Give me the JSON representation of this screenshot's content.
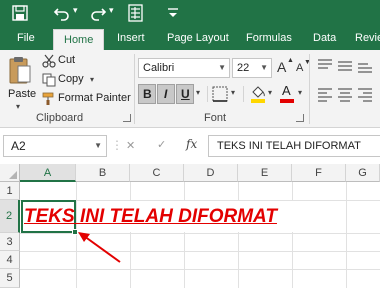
{
  "colors": {
    "accent": "#217346",
    "ribbon_bg": "#f3f3f3",
    "cell_text": "#e30000",
    "fill_highlight": "#ffd700",
    "font_color_bar": "#e30000"
  },
  "titlebar": {
    "icons": [
      "save-icon",
      "undo-icon",
      "redo-icon",
      "form-icon",
      "customize-quick-access-icon"
    ]
  },
  "tabs": [
    {
      "label": "File"
    },
    {
      "label": "Home"
    },
    {
      "label": "Insert"
    },
    {
      "label": "Page Layout"
    },
    {
      "label": "Formulas"
    },
    {
      "label": "Data"
    },
    {
      "label": "Revie"
    }
  ],
  "active_tab": "Home",
  "ribbon": {
    "clipboard": {
      "paste": "Paste",
      "cut": "Cut",
      "copy": "Copy",
      "format_painter": "Format Painter",
      "group_label": "Clipboard"
    },
    "font": {
      "font_name": "Calibri",
      "font_size": "22",
      "bold": "B",
      "italic": "I",
      "underline": "U",
      "grow_font": "A",
      "shrink_font": "A",
      "font_color_letter": "A",
      "group_label": "Font"
    }
  },
  "formula_bar": {
    "name_box": "A2",
    "cancel": "✕",
    "enter": "✓",
    "fx": "fx",
    "content": "TEKS INI TELAH DIFORMAT"
  },
  "sheet": {
    "columns": [
      "A",
      "B",
      "C",
      "D",
      "E",
      "F",
      "G"
    ],
    "selected_column": "A",
    "rows": [
      "1",
      "2",
      "3",
      "4",
      "5"
    ],
    "selected_row": "2",
    "cell_a2": "TEKS INI TELAH DIFORMAT"
  }
}
